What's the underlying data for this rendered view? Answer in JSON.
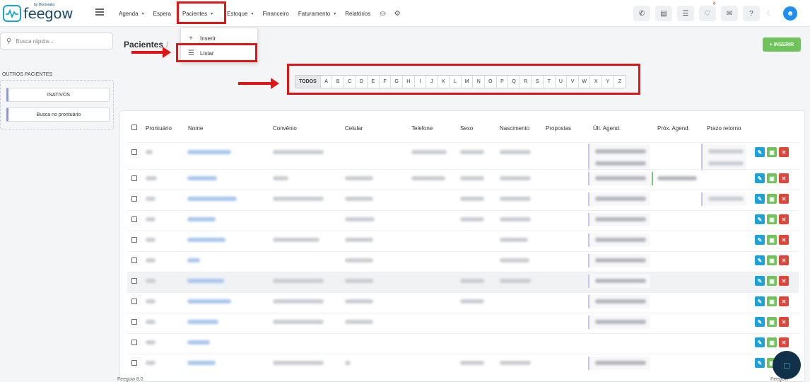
{
  "app": {
    "logo_text": "feegow",
    "logo_sub": "by Doctoralia"
  },
  "nav": {
    "items": [
      {
        "label": "Agenda",
        "caret": "▾"
      },
      {
        "label": "Espera",
        "caret": ""
      },
      {
        "label": "Pacientes",
        "caret": "▾"
      },
      {
        "label": "Estoque",
        "caret": "▾"
      },
      {
        "label": "Financeiro",
        "caret": ""
      },
      {
        "label": "Faturamento",
        "caret": "▾"
      },
      {
        "label": "Relatórios",
        "caret": ""
      }
    ],
    "icons": [
      "database-icon",
      "gear-icon"
    ]
  },
  "topbar_right": {
    "icons": [
      "phone-icon",
      "inbox-icon",
      "checklist-icon",
      "bell-icon",
      "chat-icon",
      "help-icon",
      "moon-icon"
    ],
    "notification_count": "4"
  },
  "sidebar": {
    "search_placeholder": "Busca rápida...",
    "section_title": "OUTROS PACIENTES",
    "buttons": [
      "INATIVOS",
      "Busca no prontuário"
    ]
  },
  "header": {
    "title": "Pacientes",
    "separator": "/",
    "insert_button": "+ INSERIR"
  },
  "dropdown": {
    "items": [
      {
        "icon": "+",
        "label": "Inserir"
      },
      {
        "icon": "☰",
        "label": "Listar"
      }
    ]
  },
  "alphabet": [
    "TODOS",
    "A",
    "B",
    "C",
    "D",
    "E",
    "F",
    "G",
    "H",
    "I",
    "J",
    "K",
    "L",
    "M",
    "N",
    "O",
    "P",
    "Q",
    "R",
    "S",
    "T",
    "U",
    "V",
    "W",
    "X",
    "Y",
    "Z"
  ],
  "table": {
    "columns": [
      "Prontuário",
      "Nome",
      "Convênio",
      "Celular",
      "Telefone",
      "Sexo",
      "Nascimento",
      "Propostas",
      "Últ. Agend.",
      "Próx. Agend.",
      "Prazo retorno"
    ],
    "row_count": 11
  },
  "footer": {
    "left": "Feegow 8.0",
    "right": "Feegow"
  },
  "colors": {
    "highlight": "#e01616",
    "brand": "#1aa3d1",
    "insert_green": "#6fc35a"
  }
}
